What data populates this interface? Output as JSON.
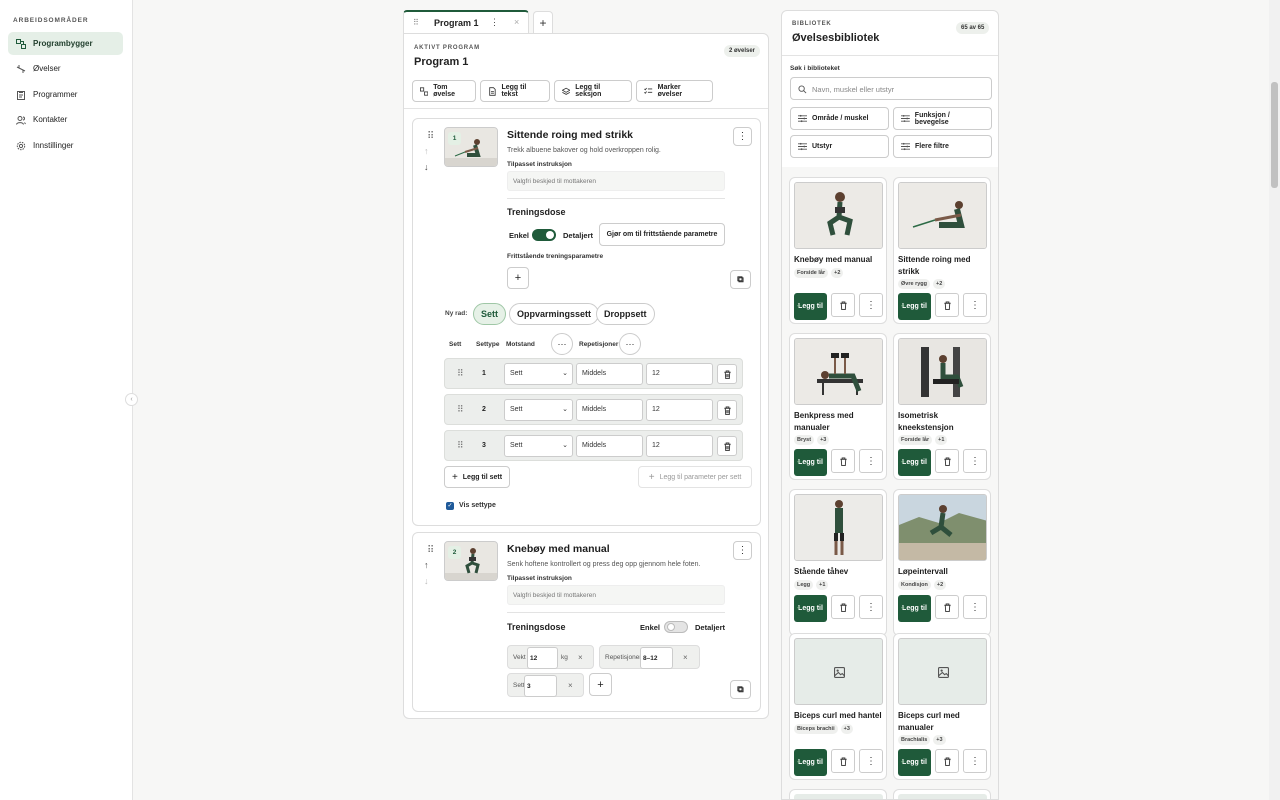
{
  "sidebar": {
    "header": "ARBEIDSOMRÅDER",
    "items": [
      {
        "label": "Programbygger",
        "icon": "builder-icon"
      },
      {
        "label": "Øvelser",
        "icon": "exercise-icon"
      },
      {
        "label": "Programmer",
        "icon": "clipboard-icon"
      },
      {
        "label": "Kontakter",
        "icon": "contacts-icon"
      },
      {
        "label": "Innstillinger",
        "icon": "gear-icon"
      }
    ]
  },
  "tabs": [
    {
      "label": "Program 1"
    }
  ],
  "program": {
    "eyebrow": "AKTIVT PROGRAM",
    "title": "Program 1",
    "count_badge": "2 øvelser",
    "toolbar": [
      "Tom øvelse",
      "Legg til tekst",
      "Legg til seksjon",
      "Marker øvelser"
    ]
  },
  "exercises": [
    {
      "num": "1",
      "title": "Sittende roing med strikk",
      "desc": "Trekk albuene bakover og hold overkroppen rolig.",
      "instr_label": "Tilpasset instruksjon",
      "instr_placeholder": "Valgfri beskjed til mottakeren",
      "dose_label": "Treningsdose",
      "mode_simple": "Enkel",
      "mode_detail": "Detaljert",
      "mode_detail_on": true,
      "convert_btn": "Gjør om til frittstående parametre",
      "free_params_label": "Frittstående treningsparametre",
      "new_row_label": "Ny rad:",
      "row_types": [
        "Sett",
        "Oppvarmingssett",
        "Droppsett"
      ],
      "columns": [
        "Sett",
        "Settype",
        "Motstand",
        "Repetisjoner"
      ],
      "sets": [
        {
          "n": "1",
          "type": "Sett",
          "resistance": "Middels",
          "reps": "12"
        },
        {
          "n": "2",
          "type": "Sett",
          "resistance": "Middels",
          "reps": "12"
        },
        {
          "n": "3",
          "type": "Sett",
          "resistance": "Middels",
          "reps": "12"
        }
      ],
      "add_set": "Legg til sett",
      "add_param": "Legg til parameter per sett",
      "show_settype": "Vis settype",
      "show_settype_checked": true
    },
    {
      "num": "2",
      "title": "Knebøy med manual",
      "desc": "Senk hoftene kontrollert og press deg opp gjennom hele foten.",
      "instr_label": "Tilpasset instruksjon",
      "instr_placeholder": "Valgfri beskjed til mottakeren",
      "dose_label": "Treningsdose",
      "mode_simple": "Enkel",
      "mode_detail": "Detaljert",
      "mode_detail_on": false,
      "params": {
        "weight_label": "Vekt",
        "weight": "12",
        "weight_unit": "kg",
        "reps_label": "Repetisjoner",
        "reps": "8–12",
        "sets_label": "Sett",
        "sets": "3"
      }
    }
  ],
  "library": {
    "eyebrow": "BIBLIOTEK",
    "title": "Øvelsesbibliotek",
    "count": "65 av 65",
    "search_label": "Søk i biblioteket",
    "search_placeholder": "Navn, muskel eller utstyr",
    "filters": [
      "Område / muskel",
      "Funksjon / bevegelse",
      "Utstyr",
      "Flere filtre"
    ],
    "add_label": "Legg til",
    "cards": [
      {
        "name": "Knebøy med manual",
        "tag": "Forside lår",
        "more": "+2",
        "img": "squat"
      },
      {
        "name": "Sittende roing med strikk",
        "tag": "Øvre rygg",
        "more": "+2",
        "img": "row"
      },
      {
        "name": "Benkpress med manualer",
        "tag": "Bryst",
        "more": "+3",
        "img": "bench"
      },
      {
        "name": "Isometrisk kneekstensjon",
        "tag": "Forside lår",
        "more": "+1",
        "img": "knee"
      },
      {
        "name": "Stående tåhev",
        "tag": "Legg",
        "more": "+1",
        "img": "calf"
      },
      {
        "name": "Løpeintervall",
        "tag": "Kondisjon",
        "more": "+2",
        "img": "run"
      },
      {
        "name": "Biceps curl med hantel",
        "tag": "Biceps brachii",
        "more": "+3",
        "img": "none"
      },
      {
        "name": "Biceps curl med manualer",
        "tag": "Brachialis",
        "more": "+3",
        "img": "none"
      }
    ]
  },
  "colors": {
    "accent": "#1f5a3a",
    "accent_light": "#e5efe7"
  }
}
